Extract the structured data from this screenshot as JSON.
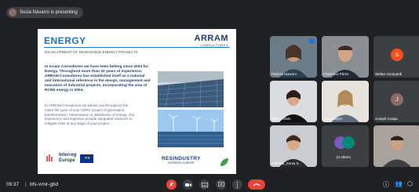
{
  "topbar": {
    "presenting": "Sucia Navarro is presenting"
  },
  "slide": {
    "title": "ENERGY",
    "logo_name": "ARRAM",
    "logo_sub": "CONSULTORES",
    "subtitle": "DEVELOPMENT OF RENEWABLE ENERGY PROJECTS",
    "bold_text": "In Arram Consultores we have been belting since 2004 for Energy. Throughout more than 32 years of experience, ARRAM Consultores has established itself as a national and international reference in the design, management and execution of industrial projects, incorporating the area of RCRE energy in 2004.",
    "paragraph": "In ARRAM Consultores we advise you throughout the entire life cycle of your CRRC project of generation, transformation, transmission or distribution of energy. Our experience and expertise provide integrated solutions to mitigate risks at any stage of your project.",
    "interreg": "Interreg",
    "interreg_sub": "Europe",
    "res_name": "RESINDUSTRY",
    "res_sub": "INTERREG EUROPE"
  },
  "participants": [
    {
      "name": "Patricia Navarro",
      "initial": ""
    },
    {
      "name": "Francisco Pérez",
      "initial": ""
    },
    {
      "name": "Stefan Asoopardi",
      "initial": "S",
      "color": "#f4511e"
    },
    {
      "name": "Milena Klein",
      "initial": ""
    },
    {
      "name": "Anna Meyer",
      "initial": ""
    },
    {
      "name": "Joseph Cotaja",
      "initial": "J",
      "color": "#8d6e63"
    },
    {
      "name": "ARRAM_Sonia S.",
      "initial": ""
    },
    {
      "name": "13 others",
      "initial": ""
    },
    {
      "name": "",
      "initial": ""
    }
  ],
  "bottombar": {
    "time": "09:37",
    "separator": "|",
    "meeting_code": "bfs-vmir-gbd"
  },
  "colors": {
    "background": "#202124",
    "tile": "#3c4043",
    "accent": "#1a73e8",
    "danger": "#ea4335"
  }
}
